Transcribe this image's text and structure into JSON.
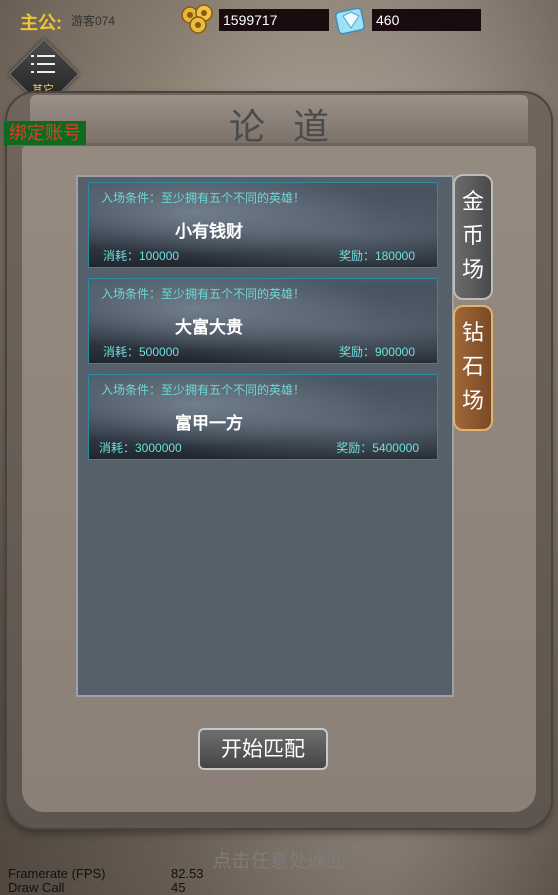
{
  "player": {
    "label": "主公:",
    "name": "游客074"
  },
  "currency": {
    "coins": "1599717",
    "gems": "460"
  },
  "menu": {
    "label": "其它"
  },
  "title": "论道",
  "bind_account": "绑定账号",
  "rooms": [
    {
      "condition": "入场条件：至少拥有五个不同的英雄！",
      "name": "小有钱财",
      "cost": "消耗：100000",
      "reward": "奖励：180000"
    },
    {
      "condition": "入场条件：至少拥有五个不同的英雄！",
      "name": "大富大贵",
      "cost": "消耗：500000",
      "reward": "奖励：900000"
    },
    {
      "condition": "入场条件：至少拥有五个不同的英雄！",
      "name": "富甲一方",
      "cost": "消耗：3000000",
      "reward": "奖励：5400000"
    }
  ],
  "tabs": [
    {
      "label": "金币场",
      "color": "#5a5a5a"
    },
    {
      "label": "钻石场",
      "color": "#8b562d"
    }
  ],
  "start_button": "开始匹配",
  "tap_to_return": "点击任意处返回",
  "stats": [
    {
      "label": "Framerate (FPS)",
      "value": "82.53"
    },
    {
      "label": "Draw Call",
      "value": "45"
    }
  ]
}
